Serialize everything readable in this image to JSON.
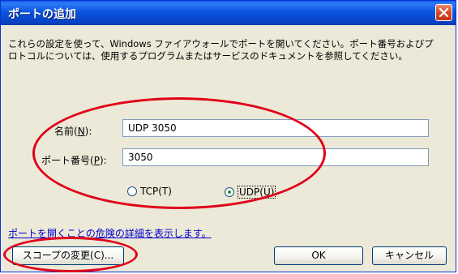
{
  "window": {
    "title": "ポートの追加",
    "close_label": "×"
  },
  "description": {
    "line1": "これらの設定を使って、Windows ファイアウォールでポートを開いてください。ポート番号およびプ",
    "line2": "ロトコルについては、使用するプログラムまたはサービスのドキュメントを参照してください。"
  },
  "form": {
    "name_label_prefix": "名前(",
    "name_label_key": "N",
    "name_label_suffix": "):",
    "name_value": "UDP 3050",
    "port_label_prefix": "ポート番号(",
    "port_label_key": "P",
    "port_label_suffix": "):",
    "port_value": "3050",
    "tcp_label": "TCP(T)",
    "udp_label": "UDP(U)",
    "selected_protocol": "UDP"
  },
  "link": {
    "text": "ポートを開くことの危険の詳細を表示します。"
  },
  "buttons": {
    "scope": "スコープの変更(C)...",
    "ok": "OK",
    "cancel": "キャンセル"
  },
  "annotation_color": "#e0001a"
}
